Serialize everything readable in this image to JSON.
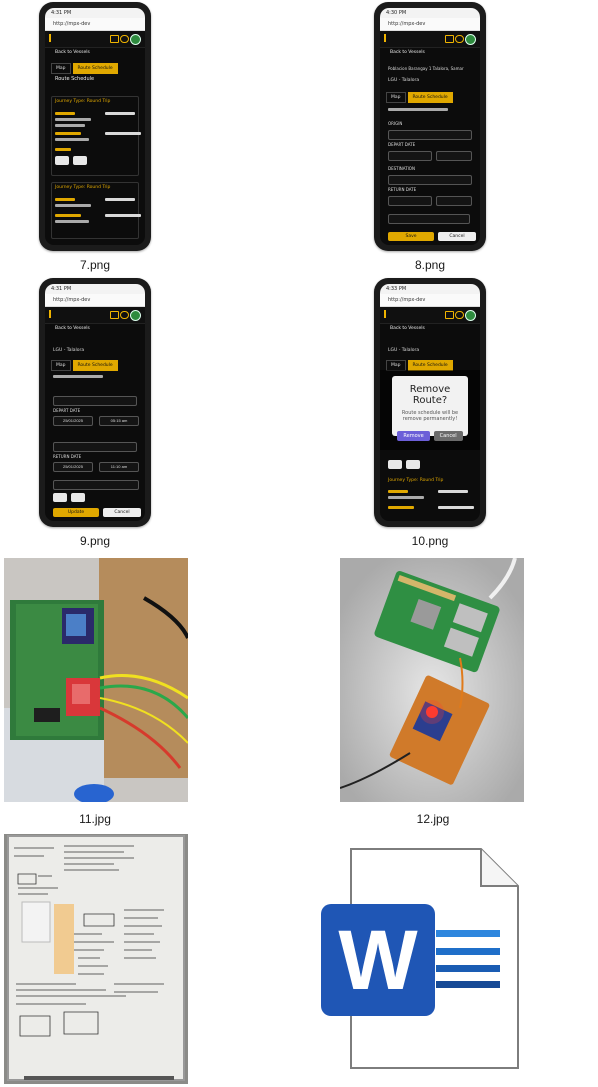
{
  "files": [
    {
      "caption": "7.png"
    },
    {
      "caption": "8.png"
    },
    {
      "caption": "9.png"
    },
    {
      "caption": "10.png"
    },
    {
      "caption": "11.jpg"
    },
    {
      "caption": "12.jpg"
    },
    {
      "caption": "",
      "kind": "whiteboard-photo"
    },
    {
      "caption": "",
      "kind": "word-document-icon"
    }
  ],
  "phone7": {
    "status": "4:31 PM",
    "url": "http://mpx-dev",
    "back": "Back to Vessels",
    "tab_map": "Map",
    "tab_route": "Route Schedule",
    "section": "Route Schedule",
    "card1_title": "Journey Type: Round Trip",
    "card2_title": "Journey Type: Round Trip"
  },
  "phone8": {
    "status": "4:30 PM",
    "url": "http://mpx-dev",
    "back": "Back to Vessels",
    "address": "Poblacion Barangay 1 Talalora, Samar",
    "agency": "LGU - Talalora",
    "tab_map": "Map",
    "tab_route": "Route Schedule",
    "origin": "ORIGIN",
    "depart_date": "DEPART DATE",
    "destination": "DESTINATION",
    "return_date": "RETURN DATE",
    "save": "Save",
    "cancel": "Cancel"
  },
  "phone9": {
    "status": "4:31 PM",
    "url": "http://mpx-dev",
    "back": "Back to Vessels",
    "agency": "LGU - Talalora",
    "tab_map": "Map",
    "tab_route": "Route Schedule",
    "depart_date": "DEPART DATE",
    "depart_value": "25/01/2025",
    "depart_time": "05:15 am",
    "return_date": "RETURN DATE",
    "return_value": "25/01/2025",
    "return_time": "11:10 am",
    "update": "Update",
    "cancel": "Cancel"
  },
  "phone10": {
    "status": "4:33 PM",
    "url": "http://mpx-dev",
    "back": "Back to Vessels",
    "agency": "LGU - Talalora",
    "tab_map": "Map",
    "tab_route": "Route Schedule",
    "modal_title": "Remove Route?",
    "modal_text": "Route schedule will be remove permanently!",
    "remove": "Remove",
    "cancel": "Cancel",
    "card_title": "Journey Type: Round Trip"
  },
  "colors": {
    "accent": "#e0a800",
    "remove": "#6c5fd8",
    "cancel": "#6b6b6b",
    "word_blue": "#1f56b5"
  },
  "icons": {
    "word": "W"
  }
}
